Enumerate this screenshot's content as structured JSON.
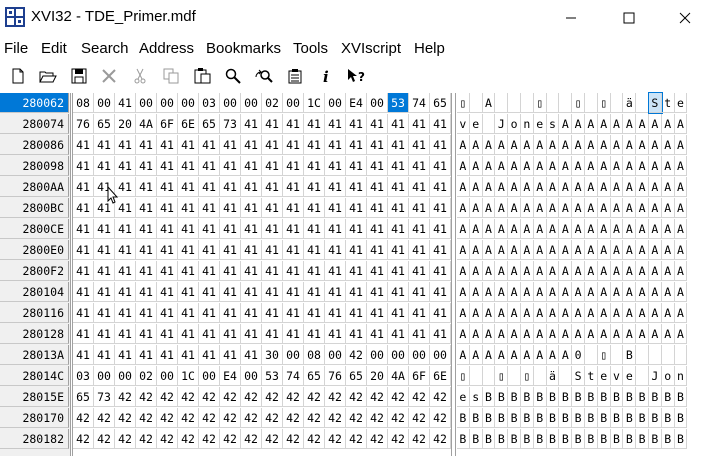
{
  "window": {
    "title": "XVI32 - TDE_Primer.mdf"
  },
  "menu": [
    "File",
    "Edit",
    "Search",
    "Address",
    "Bookmarks",
    "Tools",
    "XVIscript",
    "Help"
  ],
  "toolbar": [
    {
      "name": "new-file-icon"
    },
    {
      "name": "open-folder-icon"
    },
    {
      "name": "save-icon"
    },
    {
      "name": "close-file-icon"
    },
    {
      "name": "cut-icon"
    },
    {
      "name": "copy-icon"
    },
    {
      "name": "paste-icon"
    },
    {
      "name": "find-icon"
    },
    {
      "name": "replace-icon"
    },
    {
      "name": "properties-icon"
    },
    {
      "name": "info-icon"
    },
    {
      "name": "context-help-icon"
    }
  ],
  "rows": [
    {
      "addr": "280062",
      "hex": [
        "08",
        "00",
        "41",
        "00",
        "00",
        "00",
        "03",
        "00",
        "00",
        "02",
        "00",
        "1C",
        "00",
        "E4",
        "00",
        "53",
        "74",
        "65"
      ],
      "text": [
        "▯",
        "",
        "A",
        "",
        "",
        "",
        "▯",
        "",
        "",
        "▯",
        "",
        "▯",
        "",
        "ä",
        "",
        "S",
        "t",
        "e"
      ],
      "active": true,
      "selCol": 15
    },
    {
      "addr": "280074",
      "hex": [
        "76",
        "65",
        "20",
        "4A",
        "6F",
        "6E",
        "65",
        "73",
        "41",
        "41",
        "41",
        "41",
        "41",
        "41",
        "41",
        "41",
        "41",
        "41"
      ],
      "text": [
        "v",
        "e",
        " ",
        "J",
        "o",
        "n",
        "e",
        "s",
        "A",
        "A",
        "A",
        "A",
        "A",
        "A",
        "A",
        "A",
        "A",
        "A"
      ]
    },
    {
      "addr": "280086",
      "hex": [
        "41",
        "41",
        "41",
        "41",
        "41",
        "41",
        "41",
        "41",
        "41",
        "41",
        "41",
        "41",
        "41",
        "41",
        "41",
        "41",
        "41",
        "41"
      ],
      "text": [
        "A",
        "A",
        "A",
        "A",
        "A",
        "A",
        "A",
        "A",
        "A",
        "A",
        "A",
        "A",
        "A",
        "A",
        "A",
        "A",
        "A",
        "A"
      ]
    },
    {
      "addr": "280098",
      "hex": [
        "41",
        "41",
        "41",
        "41",
        "41",
        "41",
        "41",
        "41",
        "41",
        "41",
        "41",
        "41",
        "41",
        "41",
        "41",
        "41",
        "41",
        "41"
      ],
      "text": [
        "A",
        "A",
        "A",
        "A",
        "A",
        "A",
        "A",
        "A",
        "A",
        "A",
        "A",
        "A",
        "A",
        "A",
        "A",
        "A",
        "A",
        "A"
      ]
    },
    {
      "addr": "2800AA",
      "hex": [
        "41",
        "41",
        "41",
        "41",
        "41",
        "41",
        "41",
        "41",
        "41",
        "41",
        "41",
        "41",
        "41",
        "41",
        "41",
        "41",
        "41",
        "41"
      ],
      "text": [
        "A",
        "A",
        "A",
        "A",
        "A",
        "A",
        "A",
        "A",
        "A",
        "A",
        "A",
        "A",
        "A",
        "A",
        "A",
        "A",
        "A",
        "A"
      ]
    },
    {
      "addr": "2800BC",
      "hex": [
        "41",
        "41",
        "41",
        "41",
        "41",
        "41",
        "41",
        "41",
        "41",
        "41",
        "41",
        "41",
        "41",
        "41",
        "41",
        "41",
        "41",
        "41"
      ],
      "text": [
        "A",
        "A",
        "A",
        "A",
        "A",
        "A",
        "A",
        "A",
        "A",
        "A",
        "A",
        "A",
        "A",
        "A",
        "A",
        "A",
        "A",
        "A"
      ]
    },
    {
      "addr": "2800CE",
      "hex": [
        "41",
        "41",
        "41",
        "41",
        "41",
        "41",
        "41",
        "41",
        "41",
        "41",
        "41",
        "41",
        "41",
        "41",
        "41",
        "41",
        "41",
        "41"
      ],
      "text": [
        "A",
        "A",
        "A",
        "A",
        "A",
        "A",
        "A",
        "A",
        "A",
        "A",
        "A",
        "A",
        "A",
        "A",
        "A",
        "A",
        "A",
        "A"
      ]
    },
    {
      "addr": "2800E0",
      "hex": [
        "41",
        "41",
        "41",
        "41",
        "41",
        "41",
        "41",
        "41",
        "41",
        "41",
        "41",
        "41",
        "41",
        "41",
        "41",
        "41",
        "41",
        "41"
      ],
      "text": [
        "A",
        "A",
        "A",
        "A",
        "A",
        "A",
        "A",
        "A",
        "A",
        "A",
        "A",
        "A",
        "A",
        "A",
        "A",
        "A",
        "A",
        "A"
      ]
    },
    {
      "addr": "2800F2",
      "hex": [
        "41",
        "41",
        "41",
        "41",
        "41",
        "41",
        "41",
        "41",
        "41",
        "41",
        "41",
        "41",
        "41",
        "41",
        "41",
        "41",
        "41",
        "41"
      ],
      "text": [
        "A",
        "A",
        "A",
        "A",
        "A",
        "A",
        "A",
        "A",
        "A",
        "A",
        "A",
        "A",
        "A",
        "A",
        "A",
        "A",
        "A",
        "A"
      ]
    },
    {
      "addr": "280104",
      "hex": [
        "41",
        "41",
        "41",
        "41",
        "41",
        "41",
        "41",
        "41",
        "41",
        "41",
        "41",
        "41",
        "41",
        "41",
        "41",
        "41",
        "41",
        "41"
      ],
      "text": [
        "A",
        "A",
        "A",
        "A",
        "A",
        "A",
        "A",
        "A",
        "A",
        "A",
        "A",
        "A",
        "A",
        "A",
        "A",
        "A",
        "A",
        "A"
      ]
    },
    {
      "addr": "280116",
      "hex": [
        "41",
        "41",
        "41",
        "41",
        "41",
        "41",
        "41",
        "41",
        "41",
        "41",
        "41",
        "41",
        "41",
        "41",
        "41",
        "41",
        "41",
        "41"
      ],
      "text": [
        "A",
        "A",
        "A",
        "A",
        "A",
        "A",
        "A",
        "A",
        "A",
        "A",
        "A",
        "A",
        "A",
        "A",
        "A",
        "A",
        "A",
        "A"
      ]
    },
    {
      "addr": "280128",
      "hex": [
        "41",
        "41",
        "41",
        "41",
        "41",
        "41",
        "41",
        "41",
        "41",
        "41",
        "41",
        "41",
        "41",
        "41",
        "41",
        "41",
        "41",
        "41"
      ],
      "text": [
        "A",
        "A",
        "A",
        "A",
        "A",
        "A",
        "A",
        "A",
        "A",
        "A",
        "A",
        "A",
        "A",
        "A",
        "A",
        "A",
        "A",
        "A"
      ]
    },
    {
      "addr": "28013A",
      "hex": [
        "41",
        "41",
        "41",
        "41",
        "41",
        "41",
        "41",
        "41",
        "41",
        "30",
        "00",
        "08",
        "00",
        "42",
        "00",
        "00",
        "00",
        "00"
      ],
      "text": [
        "A",
        "A",
        "A",
        "A",
        "A",
        "A",
        "A",
        "A",
        "A",
        "0",
        "",
        "▯",
        "",
        "B",
        "",
        "",
        "",
        ""
      ]
    },
    {
      "addr": "28014C",
      "hex": [
        "03",
        "00",
        "00",
        "02",
        "00",
        "1C",
        "00",
        "E4",
        "00",
        "53",
        "74",
        "65",
        "76",
        "65",
        "20",
        "4A",
        "6F",
        "6E"
      ],
      "text": [
        "▯",
        "",
        "",
        "▯",
        "",
        "▯",
        "",
        "ä",
        "",
        "S",
        "t",
        "e",
        "v",
        "e",
        " ",
        "J",
        "o",
        "n"
      ]
    },
    {
      "addr": "28015E",
      "hex": [
        "65",
        "73",
        "42",
        "42",
        "42",
        "42",
        "42",
        "42",
        "42",
        "42",
        "42",
        "42",
        "42",
        "42",
        "42",
        "42",
        "42",
        "42"
      ],
      "text": [
        "e",
        "s",
        "B",
        "B",
        "B",
        "B",
        "B",
        "B",
        "B",
        "B",
        "B",
        "B",
        "B",
        "B",
        "B",
        "B",
        "B",
        "B"
      ]
    },
    {
      "addr": "280170",
      "hex": [
        "42",
        "42",
        "42",
        "42",
        "42",
        "42",
        "42",
        "42",
        "42",
        "42",
        "42",
        "42",
        "42",
        "42",
        "42",
        "42",
        "42",
        "42"
      ],
      "text": [
        "B",
        "B",
        "B",
        "B",
        "B",
        "B",
        "B",
        "B",
        "B",
        "B",
        "B",
        "B",
        "B",
        "B",
        "B",
        "B",
        "B",
        "B"
      ]
    },
    {
      "addr": "280182",
      "hex": [
        "42",
        "42",
        "42",
        "42",
        "42",
        "42",
        "42",
        "42",
        "42",
        "42",
        "42",
        "42",
        "42",
        "42",
        "42",
        "42",
        "42",
        "42"
      ],
      "text": [
        "B",
        "B",
        "B",
        "B",
        "B",
        "B",
        "B",
        "B",
        "B",
        "B",
        "B",
        "B",
        "B",
        "B",
        "B",
        "B",
        "B",
        "B"
      ]
    }
  ]
}
